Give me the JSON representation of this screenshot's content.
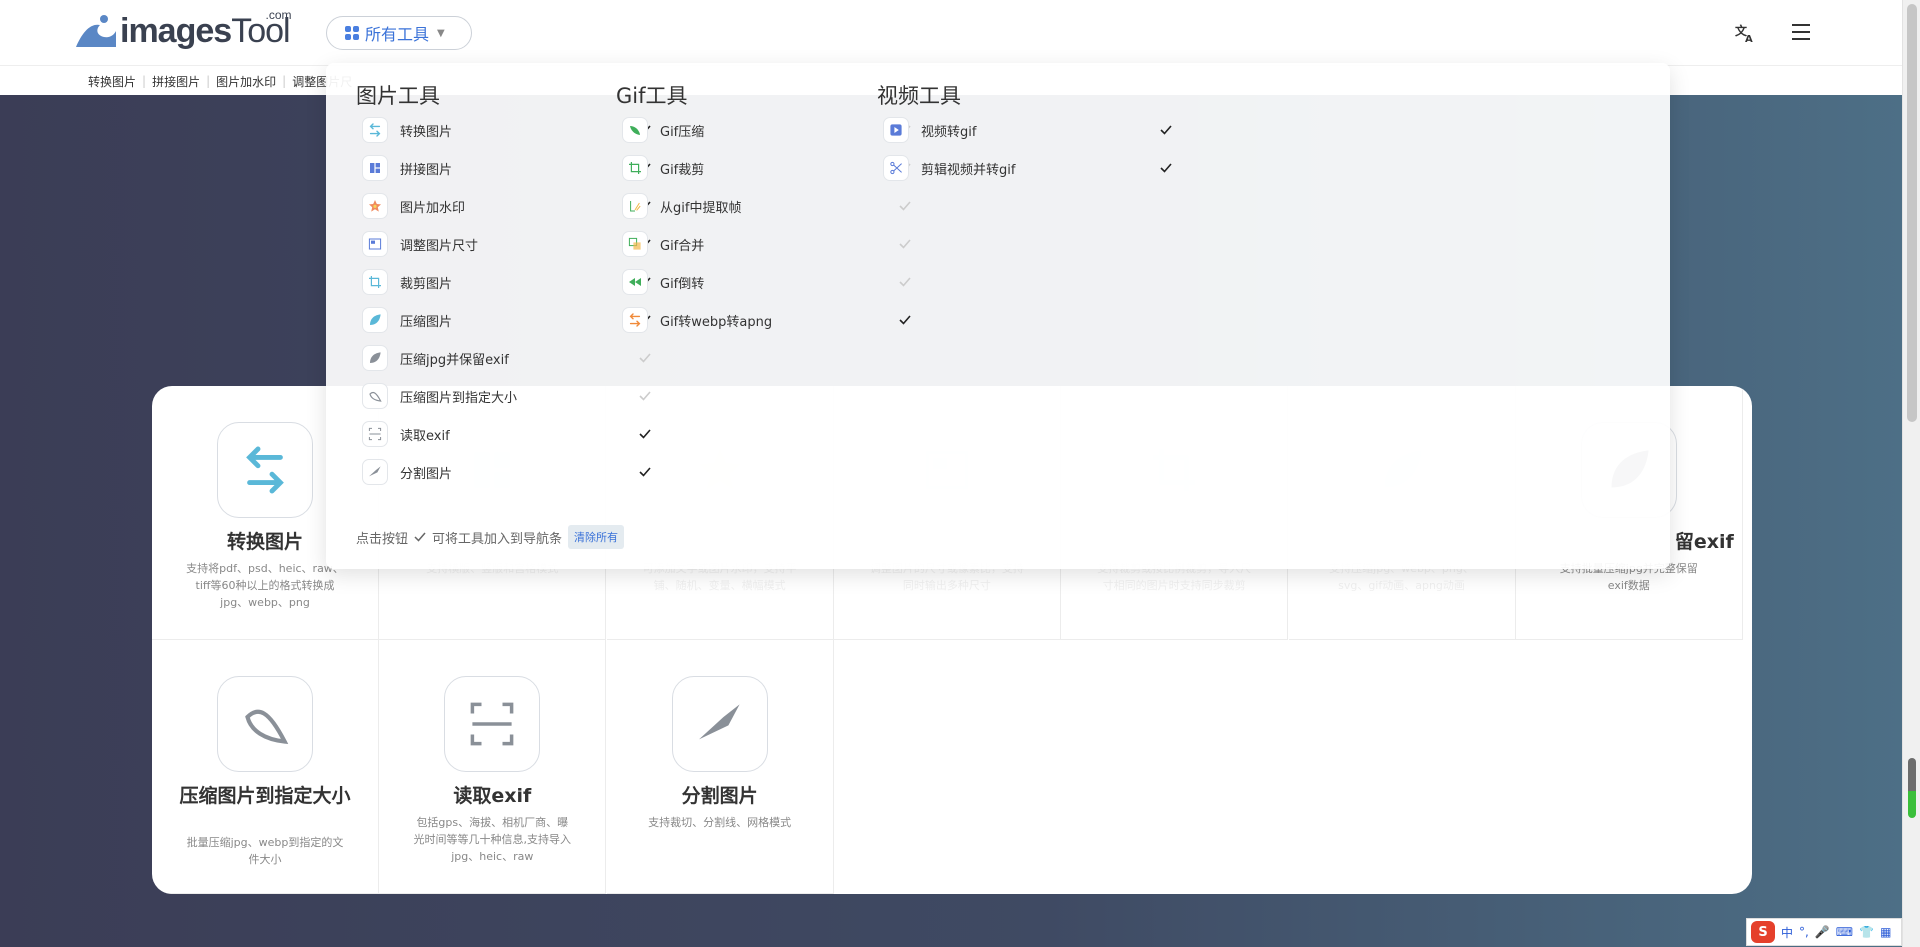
{
  "header": {
    "logo_text_images": "images",
    "logo_text_tool": "Tool",
    "logo_com": ".com",
    "all_tools_label": "所有工具"
  },
  "subnav": [
    "转换图片",
    "拼接图片",
    "图片加水印",
    "调整图片尺"
  ],
  "dropdown": {
    "columns": [
      {
        "title": "图片工具",
        "items": [
          {
            "label": "转换图片",
            "icon": "convert-arrows-icon",
            "checked": true
          },
          {
            "label": "拼接图片",
            "icon": "collage-icon",
            "checked": true
          },
          {
            "label": "图片加水印",
            "icon": "watermark-star-icon",
            "checked": true
          },
          {
            "label": "调整图片尺寸",
            "icon": "resize-icon",
            "checked": true
          },
          {
            "label": "裁剪图片",
            "icon": "crop-icon",
            "checked": true
          },
          {
            "label": "压缩图片",
            "icon": "compress-leaf-icon",
            "checked": true
          },
          {
            "label": "压缩jpg并保留exif",
            "icon": "compress-exif-icon",
            "checked": false
          },
          {
            "label": "压缩图片到指定大小",
            "icon": "compress-size-icon",
            "checked": false
          },
          {
            "label": "读取exif",
            "icon": "scan-frame-icon",
            "checked": true
          },
          {
            "label": "分割图片",
            "icon": "knife-icon",
            "checked": true
          }
        ]
      },
      {
        "title": "Gif工具",
        "items": [
          {
            "label": "Gif压缩",
            "icon": "gif-compress-icon",
            "checked": false
          },
          {
            "label": "Gif裁剪",
            "icon": "gif-crop-icon",
            "checked": false
          },
          {
            "label": "从gif中提取帧",
            "icon": "extract-frames-icon",
            "checked": false
          },
          {
            "label": "Gif合并",
            "icon": "gif-merge-icon",
            "checked": false
          },
          {
            "label": "Gif倒转",
            "icon": "rewind-icon",
            "checked": false
          },
          {
            "label": "Gif转webp转apng",
            "icon": "gif-convert-icon",
            "checked": true
          }
        ]
      },
      {
        "title": "视频工具",
        "items": [
          {
            "label": "视频转gif",
            "icon": "video-play-icon",
            "checked": true
          },
          {
            "label": "剪辑视频并转gif",
            "icon": "scissors-icon",
            "checked": true
          }
        ]
      }
    ],
    "footer_text_1": "点击按钮",
    "footer_text_2": "可将工具加入到导航条",
    "clear_all": "清除所有"
  },
  "cards": [
    {
      "title": "转换图片",
      "desc": "支持将pdf、psd、heic、raw、tiff等60种以上的格式转换成jpg、webp、png",
      "icon": "convert-arrows-icon",
      "faded": false
    },
    {
      "title": "",
      "desc": "支持横版、竖版和宫格模式",
      "icon": "collage-icon",
      "faded": true
    },
    {
      "title": "",
      "desc": "可添加文字或图片水印，支持平铺、随机、变量、横幅模式",
      "icon": "watermark-star-icon",
      "faded": true
    },
    {
      "title": "",
      "desc": "调整图片的尺寸或像素比，支持同时输出多种尺寸",
      "icon": "resize-icon",
      "faded": true
    },
    {
      "title": "",
      "desc": "支持裁剪或按比例裁剪，导入尺寸相同的图片时支持同步裁剪",
      "icon": "crop-icon",
      "faded": true
    },
    {
      "title": "",
      "desc": "支持压缩jpg、webp、png、svg、gif动画、apng动画",
      "icon": "compress-leaf-icon",
      "faded": true
    },
    {
      "title": "留exif",
      "desc": "支持批量压缩jpg并完整保留exif数据",
      "icon": "compress-exif-icon",
      "faded": false,
      "partial": true
    },
    {
      "title": "压缩图片到指定大小",
      "desc": "批量压缩jpg、webp到指定的文件大小",
      "icon": "compress-size-icon",
      "faded": false
    },
    {
      "title": "读取exif",
      "desc": "包括gps、海拔、相机厂商、曝光时间等等几十种信息,支持导入jpg、heic、raw",
      "icon": "scan-frame-icon",
      "faded": false
    },
    {
      "title": "分割图片",
      "desc": "支持裁切、分割线、网格模式",
      "icon": "knife-icon",
      "faded": false
    }
  ],
  "ime": {
    "logo": "S",
    "lang": "中"
  }
}
